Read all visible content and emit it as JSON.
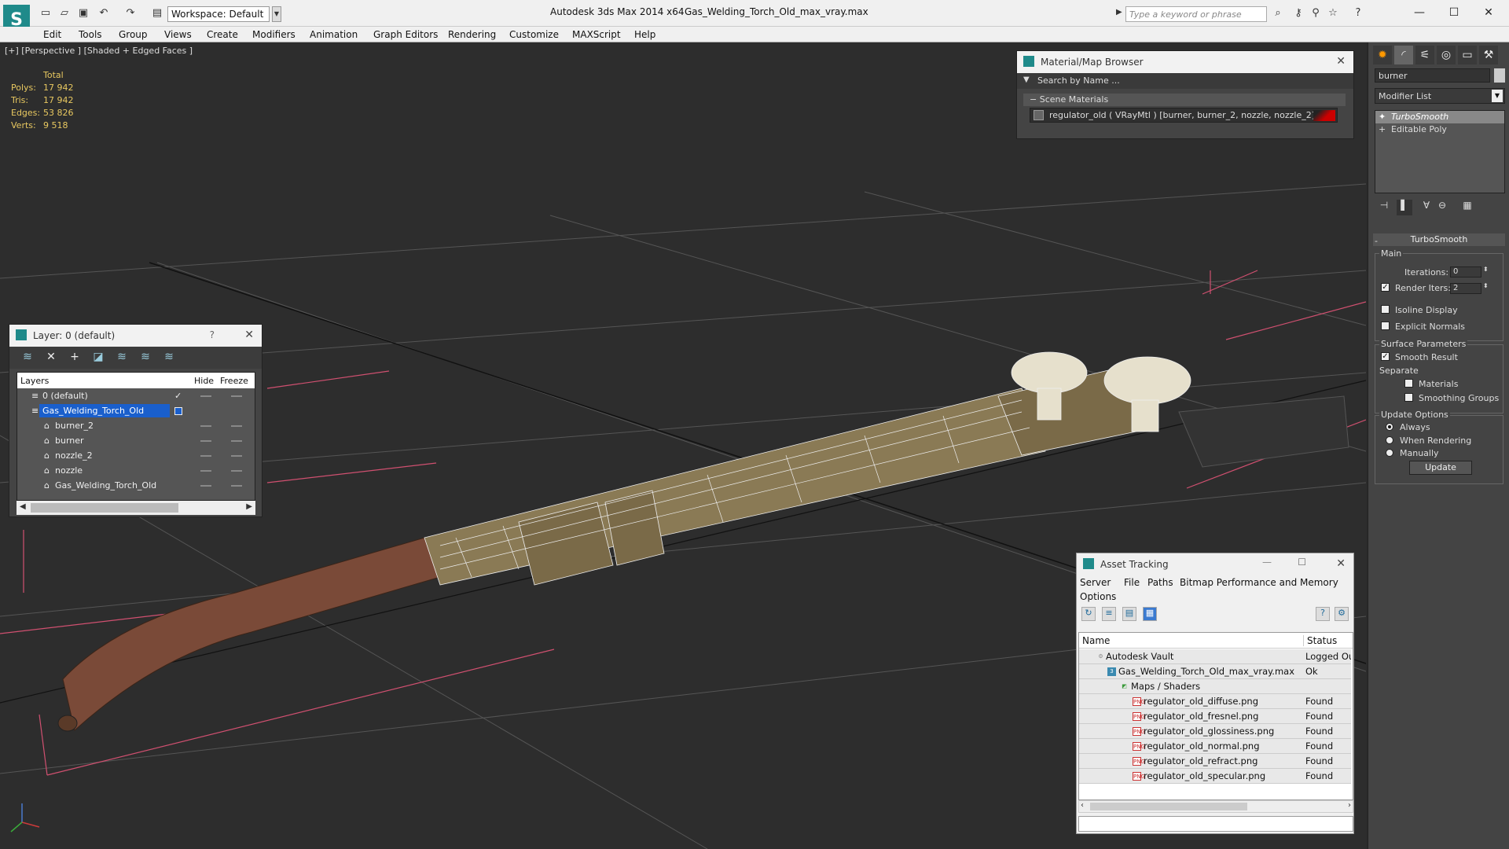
{
  "app": {
    "title": "Autodesk 3ds Max  2014 x64",
    "file": "Gas_Welding_Torch_Old_max_vray.max",
    "workspace": "Workspace: Default",
    "search_placeholder": "Type a keyword or phrase"
  },
  "menu": [
    "Edit",
    "Tools",
    "Group",
    "Views",
    "Create",
    "Modifiers",
    "Animation",
    "Graph Editors",
    "Rendering",
    "Customize",
    "MAXScript",
    "Help"
  ],
  "viewport": {
    "label": "[+] [Perspective ] [Shaded + Edged Faces ]",
    "stats": {
      "header": "Total",
      "rows": [
        {
          "label": "Polys:",
          "value": "17 942"
        },
        {
          "label": "Tris:",
          "value": "17 942"
        },
        {
          "label": "Edges:",
          "value": "53 826"
        },
        {
          "label": "Verts:",
          "value": "9 518"
        }
      ]
    }
  },
  "layer_panel": {
    "title": "Layer: 0 (default)",
    "help": "?",
    "columns": {
      "layers": "Layers",
      "hide": "Hide",
      "freeze": "Freeze"
    },
    "rows": [
      {
        "name": "0 (default)"
      },
      {
        "name": "Gas_Welding_Torch_Old"
      },
      {
        "name": "burner_2"
      },
      {
        "name": "burner"
      },
      {
        "name": "nozzle_2"
      },
      {
        "name": "nozzle"
      },
      {
        "name": "Gas_Welding_Torch_Old"
      }
    ]
  },
  "material_browser": {
    "title": "Material/Map Browser",
    "search_placeholder": "Search by Name ...",
    "section": "Scene Materials",
    "item": "regulator_old  ( VRayMtl )  [burner, burner_2, nozzle, nozzle_2]"
  },
  "command_panel": {
    "object_name": "burner",
    "modifier_list": "Modifier List",
    "stack": [
      "TurboSmooth",
      "Editable Poly"
    ],
    "rollout": "TurboSmooth",
    "main_label": "Main",
    "iterations_label": "Iterations:",
    "iterations_value": "0",
    "render_iters_label": "Render Iters:",
    "render_iters_value": "2",
    "isoline": "Isoline Display",
    "explicit_normals": "Explicit Normals",
    "surface_params": "Surface Parameters",
    "smooth_result": "Smooth Result",
    "separate": "Separate",
    "materials": "Materials",
    "smoothing_groups": "Smoothing Groups",
    "update_options": "Update Options",
    "always": "Always",
    "when_rendering": "When Rendering",
    "manually": "Manually",
    "update_button": "Update"
  },
  "asset_tracking": {
    "title": "Asset Tracking",
    "menu": [
      "Server",
      "File",
      "Paths",
      "Bitmap Performance and Memory",
      "Options"
    ],
    "columns": {
      "name": "Name",
      "status": "Status"
    },
    "rows": [
      {
        "name": "Autodesk Vault",
        "status": "Logged Ou"
      },
      {
        "name": "Gas_Welding_Torch_Old_max_vray.max",
        "status": "Ok"
      },
      {
        "name": "Maps / Shaders",
        "status": ""
      },
      {
        "name": "regulator_old_diffuse.png",
        "status": "Found"
      },
      {
        "name": "regulator_old_fresnel.png",
        "status": "Found"
      },
      {
        "name": "regulator_old_glossiness.png",
        "status": "Found"
      },
      {
        "name": "regulator_old_normal.png",
        "status": "Found"
      },
      {
        "name": "regulator_old_refract.png",
        "status": "Found"
      },
      {
        "name": "regulator_old_specular.png",
        "status": "Found"
      }
    ]
  },
  "colors": {
    "selection": "#1a5fcc",
    "stats_text": "#e8c860",
    "teal_accent": "#1f8a8a"
  }
}
